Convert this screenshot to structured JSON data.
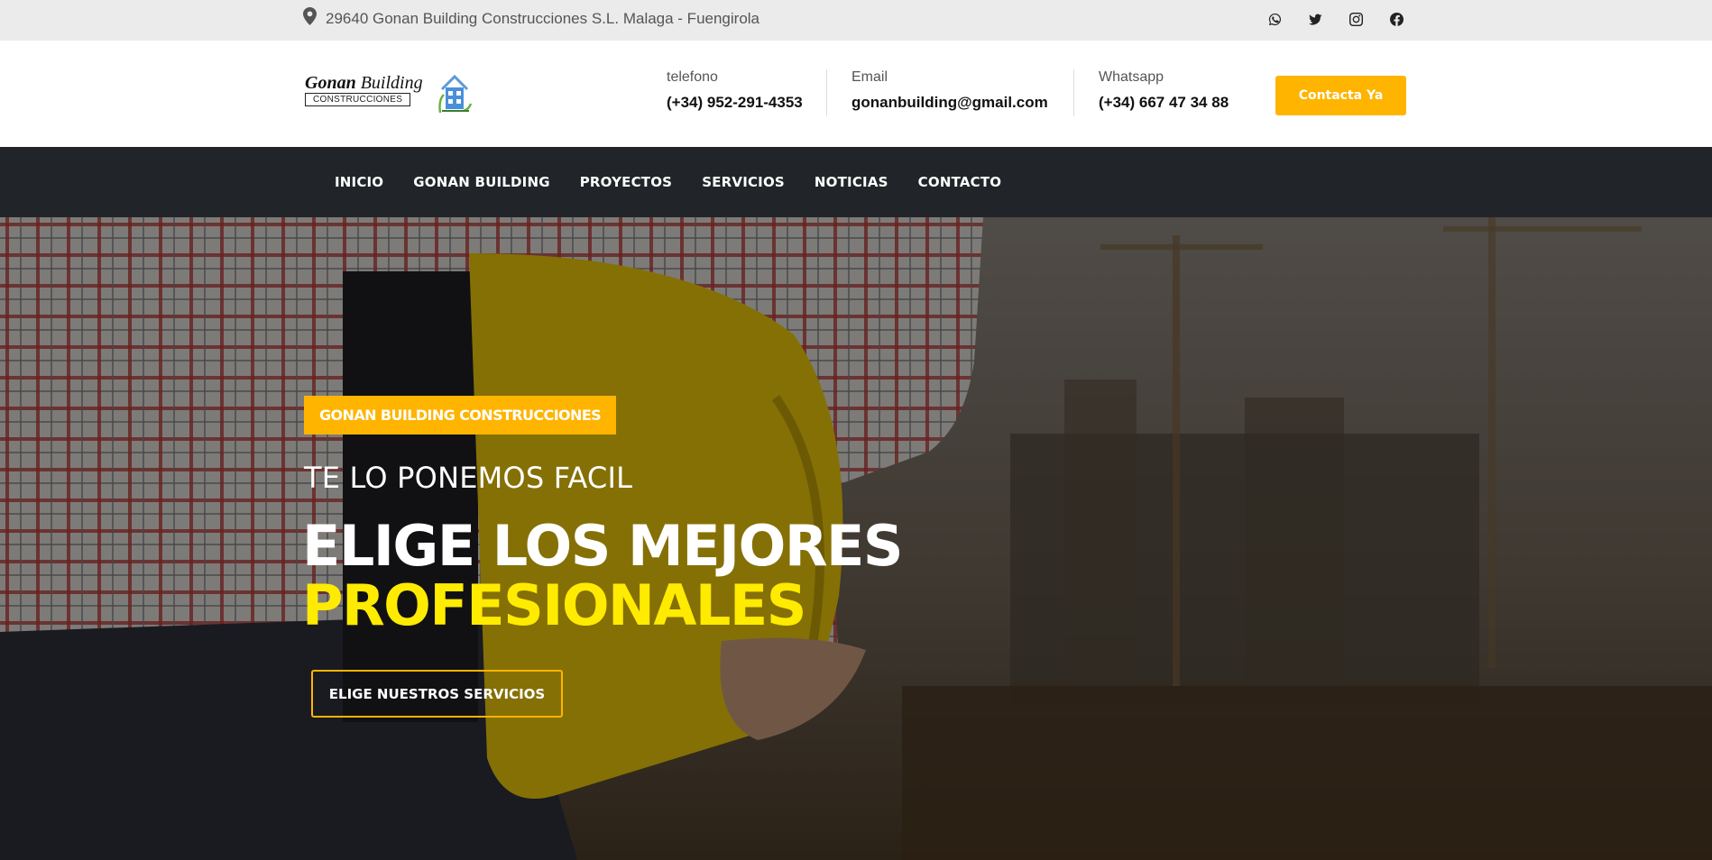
{
  "topbar": {
    "address": "29640 Gonan Building Construcciones S.L. Malaga - Fuengirola",
    "social": [
      "whatsapp-icon",
      "twitter-icon",
      "instagram-icon",
      "facebook-icon"
    ]
  },
  "header": {
    "logo": {
      "script_main": "Gonan",
      "script_rest": "Building",
      "subtitle": "CONSTRUCCIONES"
    },
    "contacts": [
      {
        "label": "telefono",
        "value": "(+34) 952-291-4353"
      },
      {
        "label": "Email",
        "value": "gonanbuilding@gmail.com"
      },
      {
        "label": "Whatsapp",
        "value": "(+34) 667 47 34 88"
      }
    ],
    "cta_label": "Contacta Ya"
  },
  "nav": {
    "items": [
      "INICIO",
      "GONAN BUILDING",
      "PROYECTOS",
      "SERVICIOS",
      "NOTICIAS",
      "CONTACTO"
    ]
  },
  "hero": {
    "badge": "GONAN BUILDING CONSTRUCCIONES",
    "tagline": "TE LO PONEMOS FACIL",
    "headline_line1": "ELIGE LOS MEJORES",
    "headline_line2": "PROFESIONALES",
    "button_label": "ELIGE NUESTROS SERVICIOS"
  },
  "colors": {
    "accent": "#ffb400",
    "headline_highlight": "#ffeb00",
    "nav_bg": "#212529",
    "topbar_bg": "#ebebeb"
  }
}
